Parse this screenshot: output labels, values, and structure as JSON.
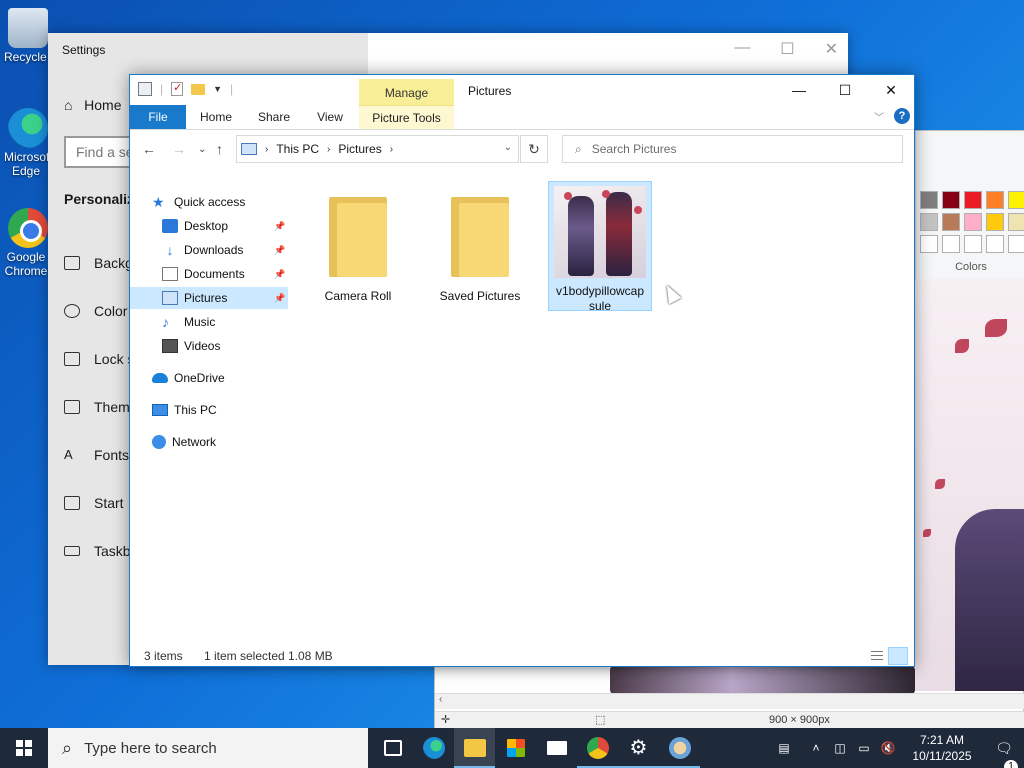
{
  "desktop": {
    "icons": [
      {
        "label": "Recycle Bin",
        "icon": "recycle-bin-icon"
      },
      {
        "label": "Microsoft Edge",
        "icon": "edge-icon"
      },
      {
        "label": "Google Chrome",
        "icon": "chrome-icon"
      }
    ]
  },
  "settings": {
    "title": "Settings",
    "home": "Home",
    "find_placeholder": "Find a se",
    "section": "Personaliz",
    "nav": [
      "Backg",
      "Color",
      "Lock s",
      "Them",
      "Fonts",
      "Start",
      "Taskb"
    ]
  },
  "paint": {
    "colors_label": "Colors",
    "dimensions": "900 × 900px",
    "palette": [
      "#7f7f7f",
      "#880015",
      "#ed1c24",
      "#ff7f27",
      "#fff200",
      "#c3c3c3",
      "#b97a57",
      "#ffaec9",
      "#ffc90e",
      "#efe4b0",
      "#ffffff",
      "#ffffff",
      "#ffffff",
      "#ffffff",
      "#ffffff"
    ]
  },
  "explorer": {
    "title": "Pictures",
    "manage_tab": "Manage",
    "ribbon_tabs": [
      "File",
      "Home",
      "Share",
      "View",
      "Picture Tools"
    ],
    "help": "?",
    "breadcrumb": [
      "This PC",
      "Pictures"
    ],
    "search_placeholder": "Search Pictures",
    "nav": {
      "quick_access": "Quick access",
      "desktop": "Desktop",
      "downloads": "Downloads",
      "documents": "Documents",
      "pictures": "Pictures",
      "music": "Music",
      "videos": "Videos",
      "onedrive": "OneDrive",
      "this_pc": "This PC",
      "network": "Network"
    },
    "items": [
      {
        "name": "Camera Roll",
        "type": "folder"
      },
      {
        "name": "Saved Pictures",
        "type": "folder"
      },
      {
        "name": "v1bodypillowcapsule",
        "type": "image",
        "selected": true
      }
    ],
    "status": {
      "count": "3 items",
      "selection": "1 item selected",
      "size": "1.08 MB"
    }
  },
  "taskbar": {
    "search_placeholder": "Type here to search",
    "pinned": [
      "task-view",
      "edge",
      "file-explorer",
      "microsoft-store",
      "mail",
      "chrome",
      "settings",
      "paint"
    ],
    "time": "7:21 AM",
    "date": "10/11/2025",
    "notification_count": "1"
  }
}
